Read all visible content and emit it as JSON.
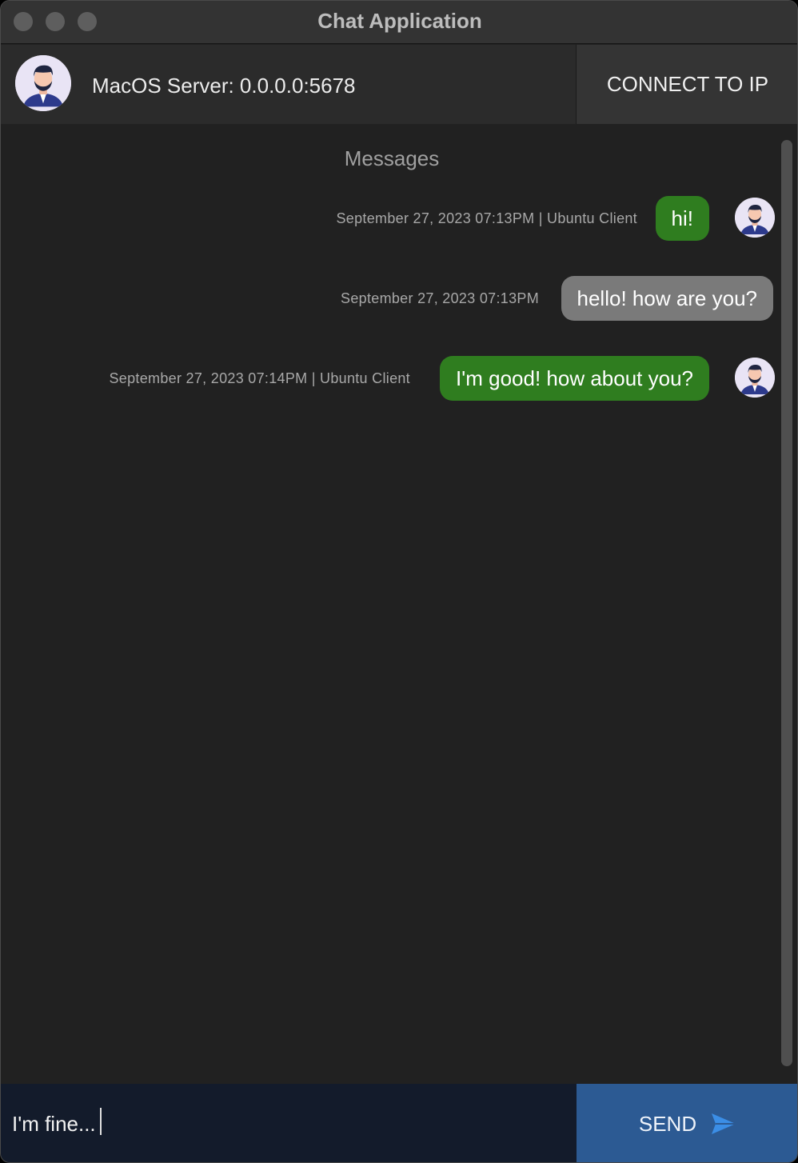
{
  "window": {
    "title": "Chat Application"
  },
  "header": {
    "server_title": "MacOS Server: 0.0.0.0:5678",
    "connect_label": "CONNECT TO IP"
  },
  "messages": {
    "heading": "Messages",
    "items": [
      {
        "text": "hi!",
        "meta": "September 27, 2023 07:13PM | Ubuntu Client",
        "sender": "Ubuntu Client",
        "color": "#2f7d1f",
        "has_avatar": true
      },
      {
        "text": "hello! how are you?",
        "meta": "September 27, 2023 07:13PM",
        "sender": "self",
        "color": "#7a7a7a",
        "has_avatar": false
      },
      {
        "text": "I'm good! how about you?",
        "meta": "September 27, 2023 07:14PM | Ubuntu Client",
        "sender": "Ubuntu Client",
        "color": "#2f7d1f",
        "has_avatar": true
      }
    ]
  },
  "composer": {
    "input_value": "I'm fine...",
    "send_label": "SEND",
    "send_icon": "send-arrow-icon",
    "send_icon_color": "#3b8ee6"
  },
  "colors": {
    "background": "#212121",
    "header": "#2b2b2b",
    "incoming_bubble": "#2f7d1f",
    "outgoing_bubble": "#7a7a7a",
    "send_button": "#2c5a93"
  }
}
